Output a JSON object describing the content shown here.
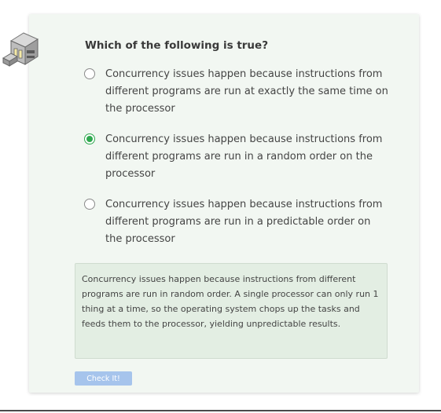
{
  "question": {
    "title": "Which of the following is true?"
  },
  "options": [
    {
      "text": "Concurrency issues happen because instructions from different programs are run at exactly the same time on the processor",
      "selected": false
    },
    {
      "text": "Concurrency issues happen because instructions from different programs are run in a random order on the processor",
      "selected": true
    },
    {
      "text": "Concurrency issues happen because instructions from different programs are run in a predictable order on the processor",
      "selected": false
    }
  ],
  "feedback": {
    "text": "Concurrency issues happen because instructions from different programs are run in random order. A single processor can only run 1 thing at a time, so the operating system chops up the tasks and feeds them to the processor, yielding unpredictable results."
  },
  "actions": {
    "check_label": "Check It!"
  },
  "colors": {
    "card_background": "#f2f7f2",
    "feedback_background": "#e3eee3",
    "selected_radio": "#2fa84f",
    "button_background": "#a6c4ec"
  },
  "icons": {
    "mascot": "robot-mascot-icon",
    "selected_option": "radio-checked-icon",
    "unselected_option": "radio-unchecked-icon"
  }
}
